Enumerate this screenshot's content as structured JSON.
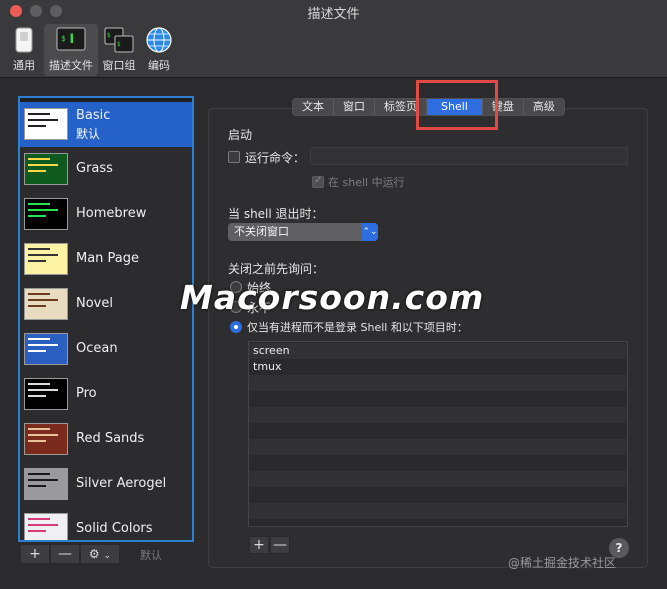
{
  "window": {
    "title": "描述文件"
  },
  "toolbar": {
    "items": [
      {
        "label": "通用",
        "icon": "switch-icon"
      },
      {
        "label": "描述文件",
        "icon": "terminal-icon",
        "selected": true
      },
      {
        "label": "窗口组",
        "icon": "window-group-icon"
      },
      {
        "label": "编码",
        "icon": "globe-icon"
      }
    ]
  },
  "sidebar": {
    "profiles": [
      {
        "name": "Basic",
        "sub": "默认",
        "selected": true,
        "bg": "#ffffff",
        "fg": "#222222"
      },
      {
        "name": "Grass",
        "bg": "#0f5a1e",
        "fg": "#ffd84a"
      },
      {
        "name": "Homebrew",
        "bg": "#000000",
        "fg": "#27e24a"
      },
      {
        "name": "Man Page",
        "bg": "#fdf3a5",
        "fg": "#333333"
      },
      {
        "name": "Novel",
        "bg": "#e8dcc0",
        "fg": "#6b3d1e"
      },
      {
        "name": "Ocean",
        "bg": "#2b5fbf",
        "fg": "#ffffff"
      },
      {
        "name": "Pro",
        "bg": "#000000",
        "fg": "#dcdcdc"
      },
      {
        "name": "Red Sands",
        "bg": "#7a2b1e",
        "fg": "#e8c29a"
      },
      {
        "name": "Silver Aerogel",
        "bg": "#9a9a9e",
        "fg": "#1a1a1a"
      },
      {
        "name": "Solid Colors",
        "bg": "#f0f0f2",
        "fg": "#d33a7a"
      }
    ],
    "footer": {
      "add": "+",
      "remove": "—",
      "gear": "⚙",
      "chevron": "⌄",
      "default_label": "默认"
    }
  },
  "tabs": [
    {
      "label": "文本"
    },
    {
      "label": "窗口"
    },
    {
      "label": "标签页"
    },
    {
      "label": "Shell",
      "active": true
    },
    {
      "label": "键盘"
    },
    {
      "label": "高级"
    }
  ],
  "startup": {
    "heading": "启动",
    "run_command_label": "运行命令：",
    "run_in_shell_label": "在 shell 中运行"
  },
  "on_exit": {
    "heading": "当 shell 退出时：",
    "selected": "不关闭窗口",
    "arrow": "⌃⌄"
  },
  "ask_before_close": {
    "heading": "关闭之前先询问：",
    "options": [
      {
        "label": "始终",
        "selected": false
      },
      {
        "label": "永不",
        "selected": false
      },
      {
        "label": "仅当有进程而不是登录 Shell 和以下项目时：",
        "selected": true
      }
    ]
  },
  "process_list": {
    "items": [
      "screen",
      "tmux"
    ],
    "add": "+",
    "remove": "—"
  },
  "help": {
    "label": "?"
  },
  "watermark": {
    "text": "Macorsoon.com"
  },
  "credit": {
    "text": "@稀土掘金技术社区"
  },
  "colors": {
    "accent": "#2f6ee0",
    "sidebar_border": "#2f7fd1",
    "highlight": "#e24a45"
  }
}
